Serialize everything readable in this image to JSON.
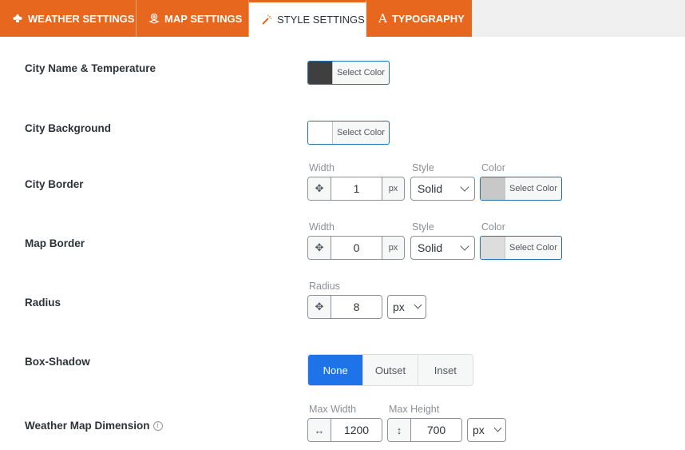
{
  "tabs": [
    {
      "label": "WEATHER SETTINGS",
      "icon": "weather-cloud-icon",
      "active": false
    },
    {
      "label": "MAP SETTINGS",
      "icon": "map-pin-icon",
      "active": false
    },
    {
      "label": "STYLE SETTINGS",
      "icon": "magic-wand-icon",
      "active": true
    },
    {
      "label": "TYPOGRAPHY",
      "icon": "font-letter-icon",
      "active": false
    }
  ],
  "colors": {
    "accent": "#e8671f",
    "active_segment": "#1e73e8",
    "city_name_swatch": "#3f3f3f",
    "city_background_swatch": "#ffffff",
    "city_border_swatch": "#c8c8c8",
    "map_border_swatch": "#dddddd"
  },
  "settings": {
    "city_name_temp": {
      "label": "City Name & Temperature",
      "button": "Select Color"
    },
    "city_background": {
      "label": "City Background",
      "button": "Select Color"
    },
    "city_border": {
      "label": "City Border",
      "width_label": "Width",
      "width_value": "1",
      "width_unit": "px",
      "style_label": "Style",
      "style_value": "Solid",
      "color_label": "Color",
      "color_button": "Select Color"
    },
    "map_border": {
      "label": "Map Border",
      "width_label": "Width",
      "width_value": "0",
      "width_unit": "px",
      "style_label": "Style",
      "style_value": "Solid",
      "color_label": "Color",
      "color_button": "Select Color"
    },
    "radius": {
      "label": "Radius",
      "field_label": "Radius",
      "value": "8",
      "unit": "px"
    },
    "box_shadow": {
      "label": "Box-Shadow",
      "options": [
        "None",
        "Outset",
        "Inset"
      ],
      "selected": "None"
    },
    "map_dimension": {
      "label": "Weather Map Dimension",
      "max_width_label": "Max Width",
      "max_width_value": "1200",
      "max_height_label": "Max Height",
      "max_height_value": "700",
      "unit": "px"
    }
  }
}
